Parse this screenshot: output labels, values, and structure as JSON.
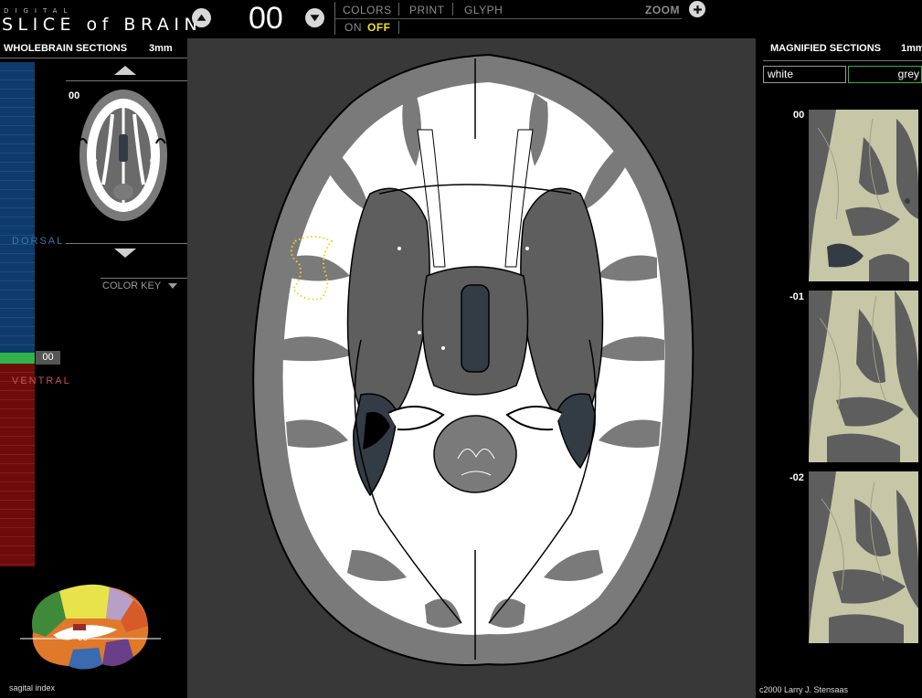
{
  "app": {
    "logo_small": "DIGITAL",
    "logo_big": "SLICE of BRAIN",
    "section_number": "00"
  },
  "toolbar": {
    "colors_label": "COLORS",
    "print_label": "PRINT",
    "glyph_label": "GLYPH",
    "zoom_label": "ZOOM",
    "on_label": "ON",
    "off_label": "OFF",
    "active_toggle": "OFF"
  },
  "left_panel": {
    "title": "WHOLEBRAIN SECTIONS",
    "thickness": "3mm",
    "thumbnail_label": "00",
    "color_key_label": "COLOR KEY",
    "dorsal_label": "DORSAL",
    "ventral_label": "VENTRAL",
    "current_index": "00",
    "sagittal_caption": "sagital index",
    "sagittal_marker": "00",
    "colors": {
      "dorsal": "#0e3b6b",
      "ventral": "#6e0c0c",
      "current": "#2fb24a"
    }
  },
  "right_panel": {
    "title": "MAGNIFIED SECTIONS",
    "thickness": "1mm",
    "field_white": "white",
    "field_grey": "grey",
    "sections": [
      {
        "label": "00"
      },
      {
        "label": "-01"
      },
      {
        "label": "-02"
      }
    ],
    "credit": "c2000 Larry J. Stensaas"
  },
  "colors": {
    "white_matter": "#ffffff",
    "grey_matter": "#7a7a7a",
    "deep_grey": "#5e5e5e",
    "ventricle": "#333c44",
    "background": "#383838",
    "highlight": "#f2d21a",
    "magnified_tissue": "#c6c7a6"
  }
}
